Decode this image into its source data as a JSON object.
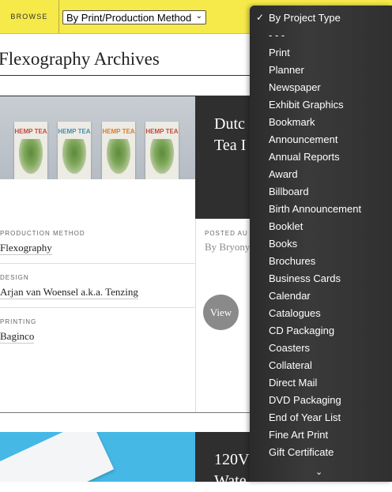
{
  "topbar": {
    "browse_label": "BROWSE",
    "select_value": "By Print/Production Method"
  },
  "page": {
    "title": "Flexography Archives"
  },
  "card1": {
    "tea_label": "HEMP TEA",
    "title_partial": "Dutc\nTea I",
    "production_method_label": "PRODUCTION METHOD",
    "production_method": "Flexography",
    "design_label": "DESIGN",
    "design": "Arjan van Woensel a.k.a. Tenzing",
    "printing_label": "PRINTING",
    "printing": "Baginco",
    "posted_label": "POSTED AU",
    "byline": "By Bryony",
    "view_label": "View"
  },
  "card2": {
    "title_partial": "120V\nWate"
  },
  "dropdown": {
    "items": [
      "By Project Type",
      "- - -",
      "Print",
      "Planner",
      "Newspaper",
      "Exhibit Graphics",
      "Bookmark",
      "Announcement",
      "Annual Reports",
      "Award",
      "Billboard",
      "Birth Announcement",
      "Booklet",
      "Books",
      "Brochures",
      "Business Cards",
      "Calendar",
      "Catalogues",
      "CD Packaging",
      "Coasters",
      "Collateral",
      "Direct Mail",
      "DVD Packaging",
      "End of Year List",
      "Fine Art Print",
      "Gift Certificate"
    ],
    "selected_index": 0,
    "check_glyph": "✓",
    "more_glyph": "⌄"
  },
  "colors": {
    "topbar": "#f6e94a",
    "menu_bg": "#333333",
    "panel_dark": "#2f2f2f",
    "tea_colors": [
      "#c9483a",
      "#3f8fb5",
      "#d97b2e",
      "#c9483a"
    ]
  }
}
